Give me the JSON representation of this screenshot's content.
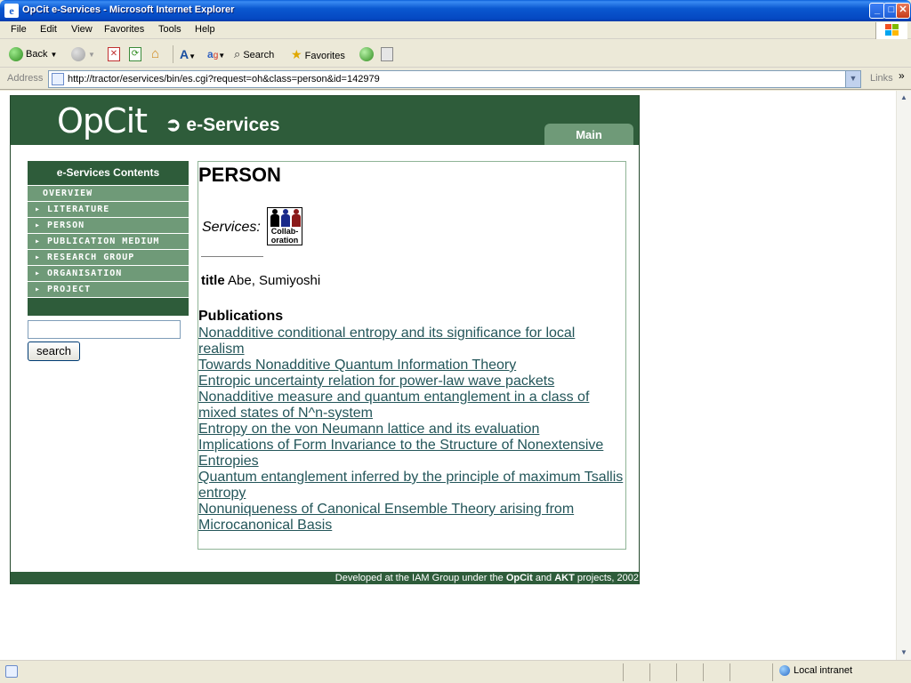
{
  "window": {
    "title": "OpCit e-Services - Microsoft Internet Explorer",
    "minimize": "_",
    "maximize": "□",
    "close": "✕"
  },
  "menu": [
    "File",
    "Edit",
    "View",
    "Favorites",
    "Tools",
    "Help"
  ],
  "toolbar": {
    "back": "Back",
    "search": "Search",
    "favorites": "Favorites"
  },
  "address": {
    "label": "Address",
    "url": "http://tractor/eservices/bin/es.cgi?request=oh&class=person&id=142979",
    "links": "Links"
  },
  "header": {
    "logo": "OpCit",
    "subtitle": "➲ e-Services",
    "main_tab": "Main"
  },
  "sidebar": {
    "heading": "e-Services Contents",
    "items": [
      {
        "label": "OVERVIEW"
      },
      {
        "label": "▸ LITERATURE"
      },
      {
        "label": "▸ PERSON"
      },
      {
        "label": "▸ PUBLICATION MEDIUM"
      },
      {
        "label": "▸ RESEARCH GROUP"
      },
      {
        "label": "▸ ORGANISATION"
      },
      {
        "label": "▸ PROJECT"
      }
    ],
    "search_value": "",
    "search_button": "search"
  },
  "person": {
    "heading": "PERSON",
    "services_label": "Services:",
    "collab_label": "Collab-oration",
    "title_key": "title",
    "title_value": "Abe, Sumiyoshi",
    "publications_heading": "Publications",
    "publications": [
      "Nonadditive conditional entropy and its significance for local realism",
      "Towards Nonadditive Quantum Information Theory",
      "Entropic uncertainty relation for power-law wave packets",
      "Nonadditive measure and quantum entanglement in a class of mixed states of N^n-system",
      "Entropy on the von Neumann lattice and its evaluation",
      "Implications of Form Invariance to the Structure of Nonextensive Entropies",
      "Quantum entanglement inferred by the principle of maximum Tsallis entropy",
      "Nonuniqueness of Canonical Ensemble Theory arising from Microcanonical Basis"
    ]
  },
  "footer": {
    "prefix": "Developed at the IAM Group under the ",
    "opcit": "OpCit",
    "and": " and ",
    "akt": "AKT",
    "suffix": " projects, 2002"
  },
  "status": {
    "zone": "Local intranet"
  },
  "colors": {
    "brand_green": "#2e5c3a",
    "menu_green": "#6f9a78",
    "link": "#24565a"
  }
}
